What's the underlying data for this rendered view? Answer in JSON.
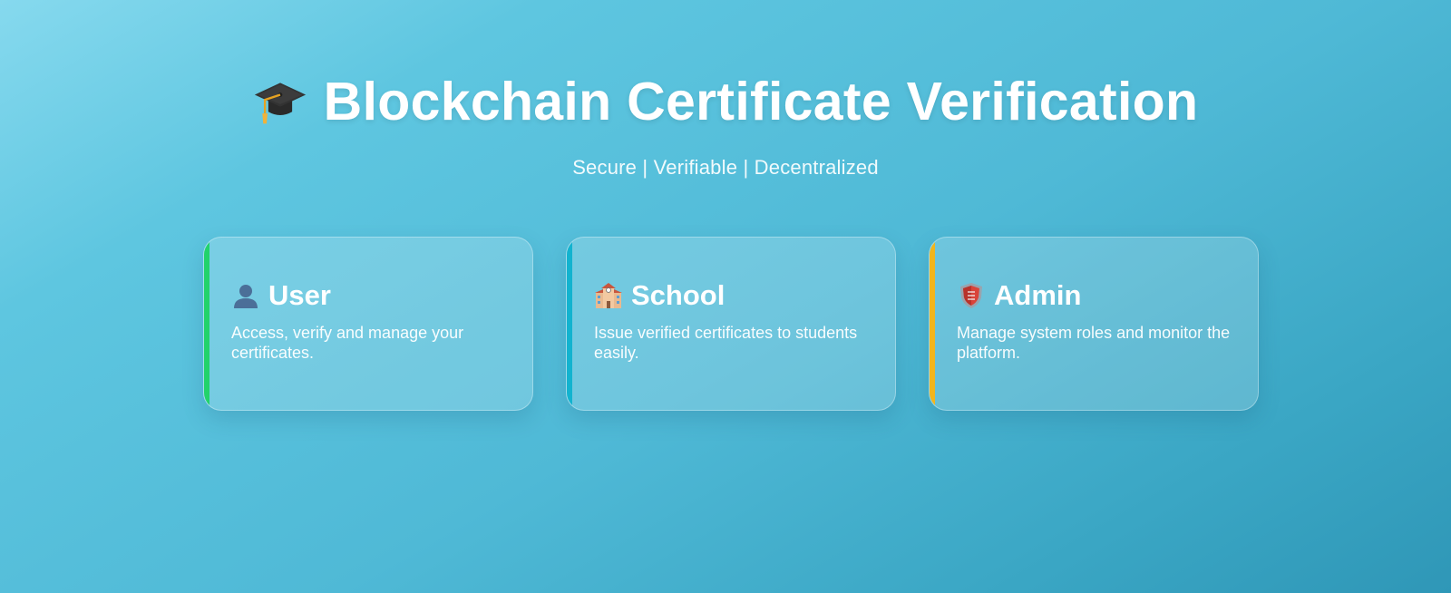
{
  "header": {
    "title": "Blockchain Certificate Verification",
    "title_icon": "graduation-cap-icon",
    "subtitle": "Secure | Verifiable | Decentralized"
  },
  "cards": [
    {
      "title": "User",
      "icon": "user-silhouette-icon",
      "description": "Access, verify and manage your certificates.",
      "accent_color": "#22d36b"
    },
    {
      "title": "School",
      "icon": "school-building-icon",
      "description": "Issue verified certificates to students easily.",
      "accent_color": "#12b3cf"
    },
    {
      "title": "Admin",
      "icon": "shield-icon",
      "description": "Manage system roles and monitor the platform.",
      "accent_color": "#f2b51c"
    }
  ]
}
